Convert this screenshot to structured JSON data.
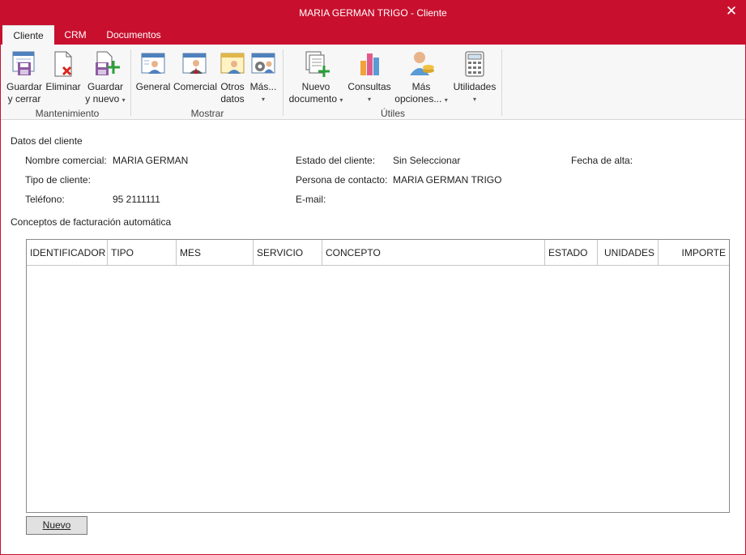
{
  "window": {
    "title": "MARIA GERMAN TRIGO - Cliente",
    "close_glyph": "✕"
  },
  "tabs": [
    "Cliente",
    "CRM",
    "Documentos"
  ],
  "ribbon": {
    "buttons": [
      {
        "line1": "Guardar",
        "line2": "y cerrar",
        "icon": "save-close-icon"
      },
      {
        "line1": "Eliminar",
        "line2": "",
        "icon": "delete-icon"
      },
      {
        "line1": "Guardar",
        "line2": "y nuevo",
        "icon": "save-new-icon",
        "dropdown": true
      },
      {
        "line1": "General",
        "line2": "",
        "icon": "general-icon"
      },
      {
        "line1": "Comercial",
        "line2": "",
        "icon": "comercial-icon"
      },
      {
        "line1": "Otros",
        "line2": "datos",
        "icon": "other-data-icon"
      },
      {
        "line1": "Más...",
        "line2": "",
        "icon": "more-icon",
        "dropdown": true
      },
      {
        "line1": "Nuevo",
        "line2": "documento",
        "icon": "new-document-icon",
        "dropdown": true
      },
      {
        "line1": "Consultas",
        "line2": "",
        "icon": "chart-icon",
        "dropdown": true
      },
      {
        "line1": "Más",
        "line2": "opciones...",
        "icon": "user-coins-icon",
        "dropdown": true
      },
      {
        "line1": "Utilidades",
        "line2": "",
        "icon": "calculator-icon",
        "dropdown": true
      }
    ],
    "groups": [
      "Mantenimiento",
      "Mostrar",
      "Útiles"
    ],
    "colors": {
      "accent": "#c8102e"
    }
  },
  "cliente": {
    "section_title": "Datos del cliente",
    "nombre_label": "Nombre comercial:",
    "nombre_value": "MARIA GERMAN",
    "tipo_label": "Tipo de cliente:",
    "tipo_value": "",
    "telefono_label": "Teléfono:",
    "telefono_value": "95 2111111",
    "estado_label": "Estado del cliente:",
    "estado_value": "Sin Seleccionar",
    "contacto_label": "Persona de contacto:",
    "contacto_value": "MARIA GERMAN TRIGO",
    "email_label": "E-mail:",
    "email_value": "",
    "alta_label": "Fecha de alta:",
    "alta_value": ""
  },
  "facturacion": {
    "section_title": "Conceptos de facturación automática",
    "columns": [
      "IDENTIFICADOR",
      "TIPO",
      "MES",
      "SERVICIO",
      "CONCEPTO",
      "ESTADO",
      "UNIDADES",
      "IMPORTE"
    ],
    "rows": [],
    "new_button": "Nuevo"
  }
}
